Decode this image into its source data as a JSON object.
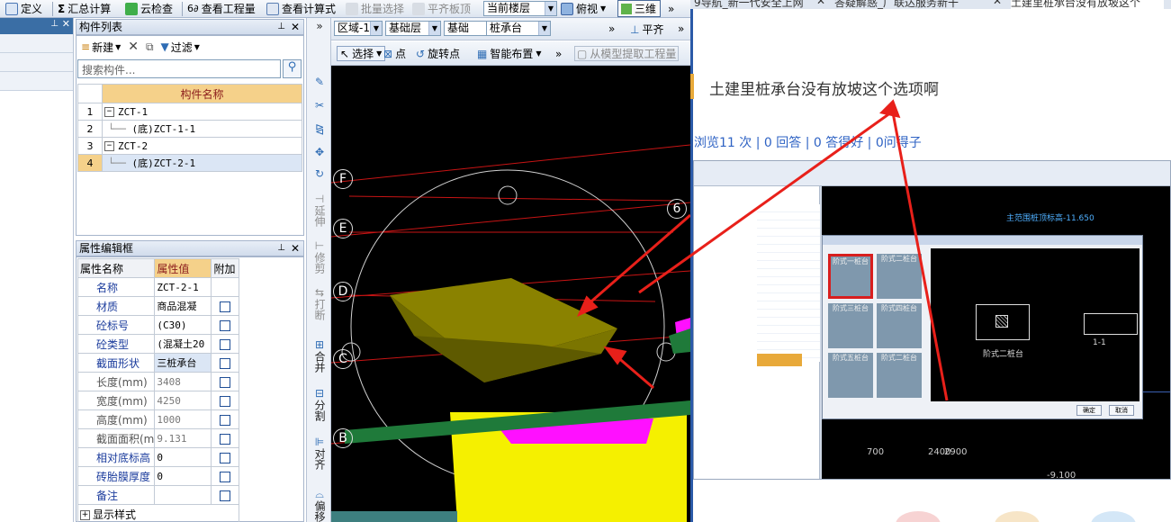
{
  "toolbar": {
    "define_label": "定义",
    "summary_label": "汇总计算",
    "cloud_check_label": "云检查",
    "view_qty_label": "查看工程量",
    "view_formula_label": "查看计算式",
    "batch_select_label": "批量选择",
    "flat_slab_label": "平齐板顶",
    "current_floor_value": "当前楼层",
    "view_mode_value": "俯视",
    "three_d_label": "三维"
  },
  "component_list": {
    "title": "构件列表",
    "new_label": "新建",
    "filter_label": "过滤",
    "search_placeholder": "搜索构件...",
    "column_header": "构件名称",
    "rows": [
      {
        "num": "1",
        "name": "ZCT-1",
        "level": 0
      },
      {
        "num": "2",
        "name": "(底)ZCT-1-1",
        "level": 1
      },
      {
        "num": "3",
        "name": "ZCT-2",
        "level": 0
      },
      {
        "num": "4",
        "name": "(底)ZCT-2-1",
        "level": 1
      }
    ],
    "selected_row": 4
  },
  "property_panel": {
    "title": "属性编辑框",
    "col_name": "属性名称",
    "col_value": "属性值",
    "col_extra": "附加",
    "rows": [
      {
        "name": "名称",
        "value": "ZCT-2-1",
        "checkbox": false,
        "gray": false
      },
      {
        "name": "材质",
        "value": "商品混凝",
        "checkbox": true,
        "gray": false
      },
      {
        "name": "砼标号",
        "value": "(C30)",
        "checkbox": true,
        "gray": false
      },
      {
        "name": "砼类型",
        "value": "(混凝土20",
        "checkbox": true,
        "gray": false
      },
      {
        "name": "截面形状",
        "value": "三桩承台",
        "checkbox": true,
        "gray": false,
        "highlight": true
      },
      {
        "name": "长度(mm)",
        "value": "3408",
        "checkbox": true,
        "gray": true
      },
      {
        "name": "宽度(mm)",
        "value": "4250",
        "checkbox": true,
        "gray": true
      },
      {
        "name": "高度(mm)",
        "value": "1000",
        "checkbox": true,
        "gray": true
      },
      {
        "name": "截面面积(m",
        "value": "9.131",
        "checkbox": true,
        "gray": true
      },
      {
        "name": "相对底标高",
        "value": "0",
        "checkbox": true,
        "gray": false
      },
      {
        "name": "砖胎膜厚度",
        "value": "0",
        "checkbox": true,
        "gray": false
      },
      {
        "name": "备注",
        "value": "",
        "checkbox": true,
        "gray": false
      }
    ],
    "footer_label": "显示样式"
  },
  "viewport_toolbar": {
    "region_value": "区域-1",
    "layer_value": "基础层",
    "category_value": "基础",
    "component_type_value": "桩承台",
    "more_label": "»",
    "align_label": "平齐",
    "select_label": "选择",
    "point_label": "点",
    "rotate_point_label": "旋转点",
    "smart_layout_label": "智能布置",
    "extract_label": "从模型提取工程量"
  },
  "vertical_tools": {
    "extend_label": "延伸",
    "trim_label": "修剪",
    "break_label": "打断",
    "merge_label": "合并",
    "split_label": "分割",
    "align_label": "对齐",
    "offset_label": "偏移"
  },
  "viewport": {
    "axis_labels": [
      "F",
      "E",
      "D",
      "C",
      "B"
    ],
    "corner_label": "6"
  },
  "browser": {
    "tabs": [
      "9导航_新一代安全上网",
      "答疑解惑_广联达服务新干",
      "土建里桩承台没有放坡这个"
    ],
    "question_title": "土建里桩承台没有放坡这个选项啊",
    "stats_text": "浏览11 次 | 0 回答 | 0 答得好 | 0问得子",
    "embedded_labels": {
      "cap_type_1": "阶式一桩台",
      "cap_type_2": "阶式二桩台",
      "cap_type_3": "阶式三桩台",
      "cap_type_4": "阶式四桩台",
      "cap_type_5": "阶式五桩台",
      "cap_type_6": "阶式二桩台",
      "preview_label": "阶式二桩台",
      "section_label": "1-1",
      "elevation_text": "主范围桩顶标高-11.650",
      "dim_700": "700",
      "dim_2400": "2400",
      "dim_2900": "2900",
      "elev_9100": "-9.100",
      "ok_label": "确定",
      "cancel_label": "取消"
    }
  },
  "colors": {
    "annotation_red": "#e8201a",
    "cap_olive": "#8a8200",
    "pile_yellow": "#f5f000",
    "magenta": "#ff10ff",
    "beam_green": "#1f7a3a",
    "grid_red": "#c81414",
    "header_orange": "#f5d18a",
    "link_blue": "#2f63c4"
  }
}
